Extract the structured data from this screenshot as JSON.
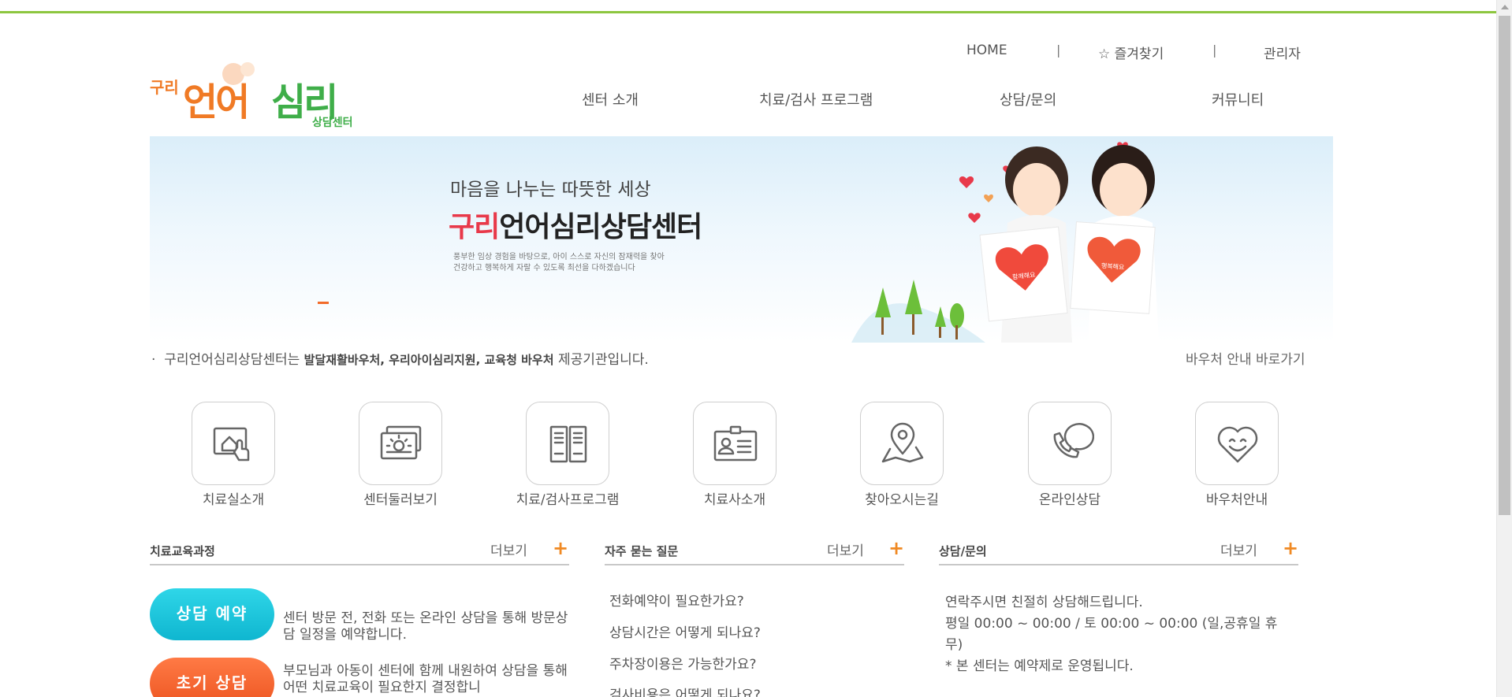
{
  "top_menu": {
    "home": "HOME",
    "bookmark": "☆ 즐겨찾기",
    "admin": "관리자",
    "separator": "|"
  },
  "logo": {
    "text_small": "구리",
    "text_main1": "언어",
    "text_main2": "심리",
    "text_sub": "상담센터"
  },
  "gnb": [
    "센터 소개",
    "치료/검사 프로그램",
    "상담/문의",
    "커뮤니티"
  ],
  "banner": {
    "line1": "마음을 나누는 따뜻한 세상",
    "title_accent": "구리",
    "title_rest": "언어심리상담센터",
    "desc1": "풍부한 임상 경험을 바탕으로, 아이 스스로 자신의 잠재력을 찾아",
    "desc2": "건강하고 행복하게 자랄 수 있도록 최선을 다하겠습니다",
    "card1": "함께해요",
    "card2": "행복해요"
  },
  "notice": {
    "bullet": "·",
    "prefix": "구리언어심리상담센터는",
    "bold": "발달재활바우처, 우리아이심리지원, 교육청 바우처",
    "suffix": "제공기관입니다.",
    "link": "바우처 안내 바로가기"
  },
  "quick_links": [
    {
      "label": "치료실소개",
      "icon": "room-touch-icon"
    },
    {
      "label": "센터둘러보기",
      "icon": "photos-icon"
    },
    {
      "label": "치료/검사프로그램",
      "icon": "book-icon"
    },
    {
      "label": "치료사소개",
      "icon": "id-card-icon"
    },
    {
      "label": "찾아오시는길",
      "icon": "map-pin-icon"
    },
    {
      "label": "온라인상담",
      "icon": "phone-bubble-icon"
    },
    {
      "label": "바우처안내",
      "icon": "heart-smile-icon"
    }
  ],
  "sections": {
    "course": {
      "title": "치료교육과정",
      "more": "더보기",
      "plus": "+",
      "items": [
        {
          "button": "상담 예약",
          "text": "센터 방문 전, 전화 또는 온라인 상담을 통해 방문상담 일정을 예약합니다."
        },
        {
          "button": "초기 상담",
          "text": "부모님과 아동이 센터에 함께 내원하여 상담을 통해 어떤 치료교육이 필요한지 결정합니"
        }
      ]
    },
    "faq": {
      "title": "자주 묻는 질문",
      "more": "더보기",
      "plus": "+",
      "items": [
        "전화예약이 필요한가요?",
        "상담시간은 어떻게 되나요?",
        "주차장이용은 가능한가요?",
        "검사비용은 어떻게 되나요?"
      ]
    },
    "contact": {
      "title": "상담/문의",
      "more": "더보기",
      "plus": "+",
      "line1": "연락주시면 친절히 상담해드립니다.",
      "line2": "평일 00:00 ~ 00:00 / 토 00:00 ~ 00:00 (일,공휴일 휴무)",
      "line3": "* 본 센터는 예약제로 운영됩니다."
    }
  },
  "colors": {
    "top_line": "#8dc63f",
    "accent_orange": "#f26b2a",
    "accent_cyan": "#14bcd4",
    "logo_orange": "#f07a25",
    "logo_green": "#3fae49"
  }
}
